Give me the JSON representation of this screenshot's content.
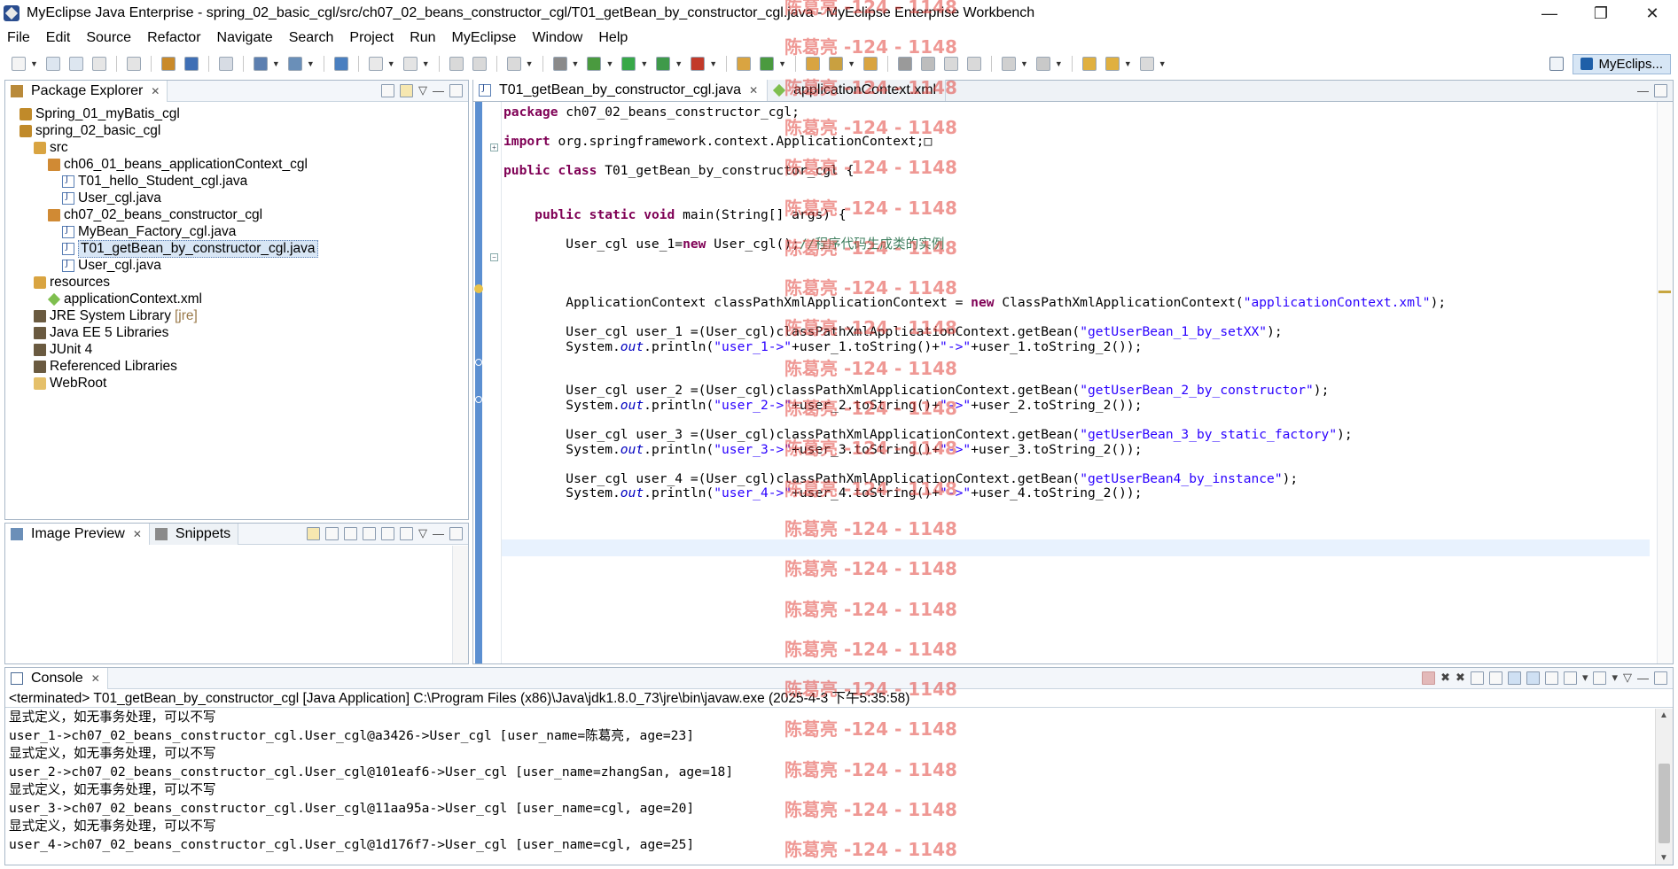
{
  "window": {
    "title": "MyEclipse Java Enterprise - spring_02_basic_cgl/src/ch07_02_beans_constructor_cgl/T01_getBean_by_constructor_cgl.java - MyEclipse Enterprise Workbench",
    "minimize": "—",
    "maximize": "❐",
    "close": "✕"
  },
  "menu": [
    "File",
    "Edit",
    "Source",
    "Refactor",
    "Navigate",
    "Search",
    "Project",
    "Run",
    "MyEclipse",
    "Window",
    "Help"
  ],
  "perspective": {
    "label": "MyEclips..."
  },
  "package_explorer": {
    "tab_label": "Package Explorer",
    "items": [
      {
        "label": "Spring_01_myBatis_cgl",
        "icon": "project-icon",
        "indent": 1
      },
      {
        "label": "spring_02_basic_cgl",
        "icon": "project-icon",
        "indent": 1
      },
      {
        "label": "src",
        "icon": "source-folder-icon",
        "indent": 2
      },
      {
        "label": "ch06_01_beans_applicationContext_cgl",
        "icon": "package-icon",
        "indent": 3
      },
      {
        "label": "T01_hello_Student_cgl.java",
        "icon": "java-file-icon",
        "indent": 4
      },
      {
        "label": "User_cgl.java",
        "icon": "java-file-icon",
        "indent": 4
      },
      {
        "label": "ch07_02_beans_constructor_cgl",
        "icon": "package-icon",
        "indent": 3
      },
      {
        "label": "MyBean_Factory_cgl.java",
        "icon": "java-file-icon",
        "indent": 4
      },
      {
        "label": "T01_getBean_by_constructor_cgl.java",
        "icon": "java-file-icon",
        "indent": 4,
        "selected": true
      },
      {
        "label": "User_cgl.java",
        "icon": "java-file-icon",
        "indent": 4
      },
      {
        "label": "resources",
        "icon": "source-folder-icon",
        "indent": 2
      },
      {
        "label": "applicationContext.xml",
        "icon": "xml-file-icon",
        "indent": 3
      },
      {
        "label": "JRE System Library",
        "tag": "[jre]",
        "icon": "library-icon",
        "indent": 2
      },
      {
        "label": "Java EE 5 Libraries",
        "icon": "library-icon",
        "indent": 2
      },
      {
        "label": "JUnit 4",
        "icon": "library-icon",
        "indent": 2
      },
      {
        "label": "Referenced Libraries",
        "icon": "library-icon",
        "indent": 2
      },
      {
        "label": "WebRoot",
        "icon": "folder-icon",
        "indent": 2
      }
    ]
  },
  "image_preview": {
    "tab_label": "Image Preview",
    "snippets_label": "Snippets"
  },
  "editor": {
    "tabs": [
      {
        "label": "T01_getBean_by_constructor_cgl.java",
        "active": true
      },
      {
        "label": "applicationContext.xml",
        "active": false
      }
    ],
    "lines": [
      {
        "row": 0,
        "parts": [
          [
            "kw",
            "package"
          ],
          [
            "",
            " ch07_02_beans_constructor_cgl;"
          ]
        ]
      },
      {
        "row": 2,
        "parts": [
          [
            "kw",
            "import"
          ],
          [
            "",
            " org.springframework.context.ApplicationContext;"
          ],
          [
            "",
            "□"
          ]
        ]
      },
      {
        "row": 4,
        "parts": [
          [
            "kw",
            "public"
          ],
          [
            "",
            " "
          ],
          [
            "kw",
            "class"
          ],
          [
            "",
            " T01_getBean_by_constructor_cgl {"
          ]
        ]
      },
      {
        "row": 7,
        "parts": [
          [
            "",
            "    "
          ],
          [
            "kw",
            "public"
          ],
          [
            "",
            " "
          ],
          [
            "kw",
            "static"
          ],
          [
            "",
            " "
          ],
          [
            "kw",
            "void"
          ],
          [
            "",
            " main(String[] args) {"
          ]
        ]
      },
      {
        "row": 9,
        "parts": [
          [
            "",
            "        User_cgl use_1="
          ],
          [
            "kw",
            "new"
          ],
          [
            "",
            " User_cgl();"
          ],
          [
            "cmt",
            "//程序代码生成类的实例"
          ]
        ]
      },
      {
        "row": 13,
        "parts": [
          [
            "",
            "        ApplicationContext classPathXmlApplicationContext = "
          ],
          [
            "kw",
            "new"
          ],
          [
            "",
            " ClassPathXmlApplicationContext("
          ],
          [
            "str",
            "\"applicationContext.xml\""
          ],
          [
            "",
            ");"
          ]
        ]
      },
      {
        "row": 15,
        "parts": [
          [
            "",
            "        User_cgl user_1 =(User_cgl)classPathXmlApplicationContext.getBean("
          ],
          [
            "str",
            "\"getUserBean_1_by_setXX\""
          ],
          [
            "",
            ");"
          ]
        ]
      },
      {
        "row": 16,
        "parts": [
          [
            "",
            "        System."
          ],
          [
            "fld",
            "out"
          ],
          [
            "",
            ".println("
          ],
          [
            "str",
            "\"user_1->\""
          ],
          [
            "",
            "+user_1.toString()+"
          ],
          [
            "str",
            "\"->\""
          ],
          [
            "",
            "+user_1.toString_2());"
          ]
        ]
      },
      {
        "row": 19,
        "parts": [
          [
            "",
            "        User_cgl user_2 =(User_cgl)classPathXmlApplicationContext.getBean("
          ],
          [
            "str",
            "\"getUserBean_2_by_constructor\""
          ],
          [
            "",
            ");"
          ]
        ]
      },
      {
        "row": 20,
        "parts": [
          [
            "",
            "        System."
          ],
          [
            "fld",
            "out"
          ],
          [
            "",
            ".println("
          ],
          [
            "str",
            "\"user_2->\""
          ],
          [
            "",
            "+user_2.toString()+"
          ],
          [
            "str",
            "\"->\""
          ],
          [
            "",
            "+user_2.toString_2());"
          ]
        ]
      },
      {
        "row": 22,
        "parts": [
          [
            "",
            "        User_cgl user_3 =(User_cgl)classPathXmlApplicationContext.getBean("
          ],
          [
            "str",
            "\"getUserBean_3_by_static_factory\""
          ],
          [
            "",
            ");"
          ]
        ]
      },
      {
        "row": 23,
        "parts": [
          [
            "",
            "        System."
          ],
          [
            "fld",
            "out"
          ],
          [
            "",
            ".println("
          ],
          [
            "str",
            "\"user_3->\""
          ],
          [
            "",
            "+user_3.toString()+"
          ],
          [
            "str",
            "\"->\""
          ],
          [
            "",
            "+user_3.toString_2());"
          ]
        ]
      },
      {
        "row": 25,
        "parts": [
          [
            "",
            "        User_cgl user_4 =(User_cgl)classPathXmlApplicationContext.getBean("
          ],
          [
            "str",
            "\"getUserBean4_by_instance\""
          ],
          [
            "",
            ");"
          ]
        ]
      },
      {
        "row": 26,
        "parts": [
          [
            "",
            "        System."
          ],
          [
            "fld",
            "out"
          ],
          [
            "",
            ".println("
          ],
          [
            "str",
            "\"user_4->\""
          ],
          [
            "",
            "+user_4.toString()+"
          ],
          [
            "str",
            "\"->\""
          ],
          [
            "",
            "+user_4.toString_2());"
          ]
        ]
      }
    ]
  },
  "console": {
    "tab_label": "Console",
    "status": "<terminated> T01_getBean_by_constructor_cgl [Java Application] C:\\Program Files (x86)\\Java\\jdk1.8.0_73\\jre\\bin\\javaw.exe (2025-4-3 下午5:35:58)",
    "lines": [
      "显式定义，如无事务处理，可以不写",
      "user_1->ch07_02_beans_constructor_cgl.User_cgl@a3426->User_cgl [user_name=陈葛亮, age=23]",
      "显式定义，如无事务处理，可以不写",
      "user_2->ch07_02_beans_constructor_cgl.User_cgl@101eaf6->User_cgl [user_name=zhangSan, age=18]",
      "显式定义，如无事务处理，可以不写",
      "user_3->ch07_02_beans_constructor_cgl.User_cgl@11aa95a->User_cgl [user_name=cgl, age=20]",
      "显式定义，如无事务处理，可以不写",
      "user_4->ch07_02_beans_constructor_cgl.User_cgl@1d176f7->User_cgl [user_name=cgl, age=25]"
    ]
  },
  "watermark": {
    "text": "陈葛亮 -124 - 1148"
  },
  "colors": {
    "keyword": "#7f0055",
    "string": "#2a00ff",
    "comment": "#3f7f5f",
    "field": "#0000c0",
    "watermark": "#e2443e"
  }
}
